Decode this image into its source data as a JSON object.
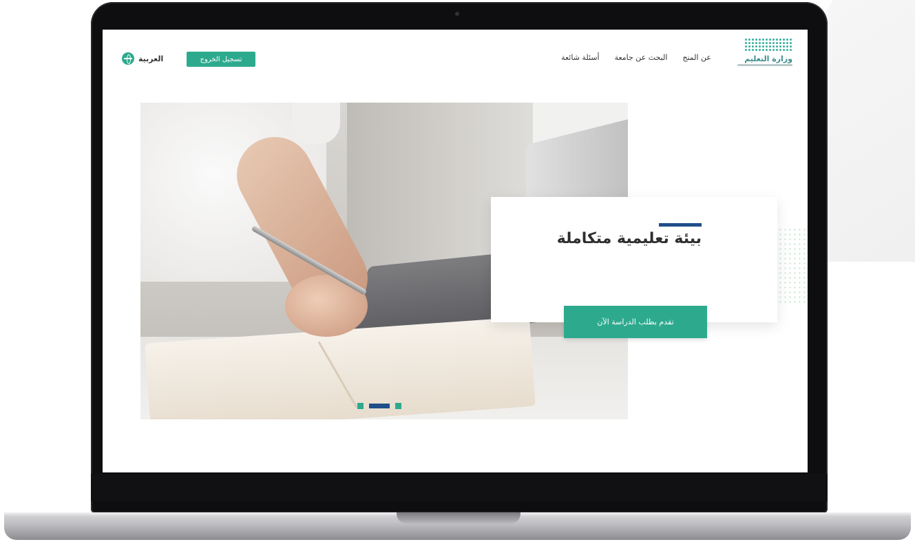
{
  "header": {
    "logo_text": "وزارة التعليم",
    "nav_items": [
      {
        "label": "عن المنح"
      },
      {
        "label": "البحث عن جامعة"
      },
      {
        "label": "أسئلة شائعة"
      }
    ],
    "login_label": "تسجيل الخروج",
    "language_label": "العربية"
  },
  "hero": {
    "title": "بيئة تعليمية متكاملة",
    "cta_label": "تقدم بطلب الدراسة الآن",
    "slides": {
      "count": 3,
      "active": 2
    }
  },
  "colors": {
    "primary": "#2daa8e",
    "accent": "#1f4e8a",
    "text": "#2e2e2e"
  },
  "icons": {
    "language": "globe-icon",
    "logo": "ministry-logo"
  }
}
